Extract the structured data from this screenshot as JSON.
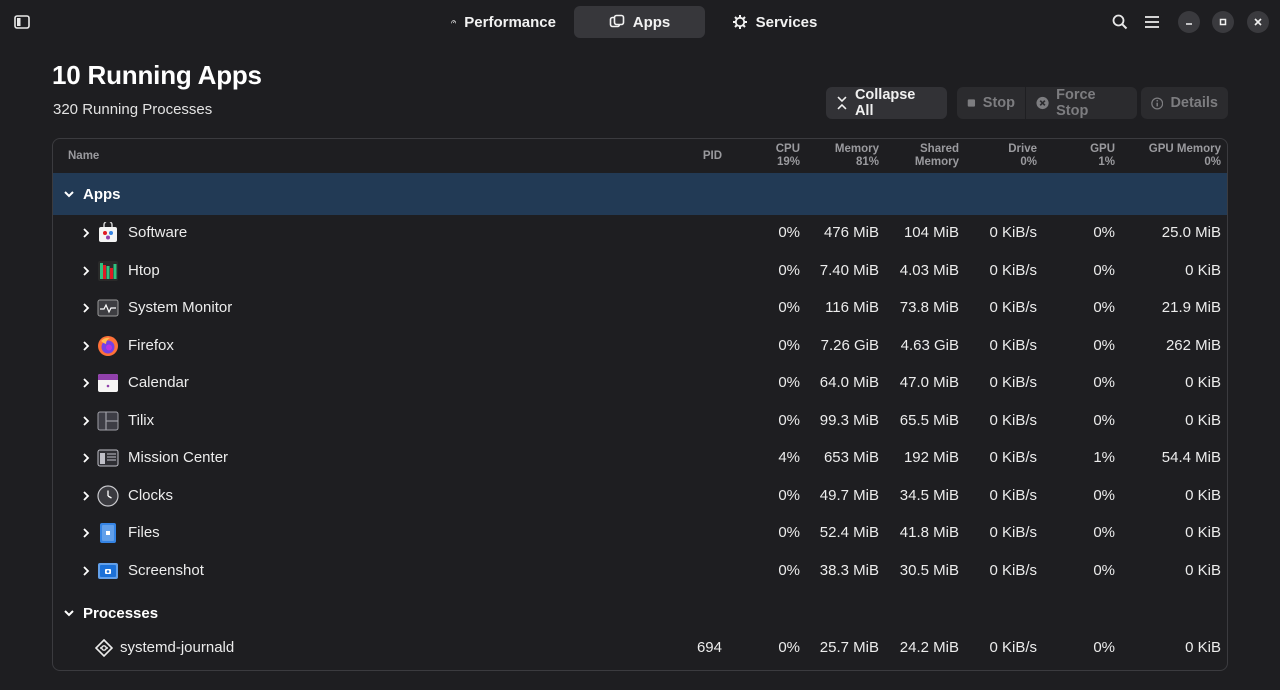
{
  "header": {
    "tabs": [
      {
        "label": "Performance",
        "icon": "gauge-icon"
      },
      {
        "label": "Apps",
        "icon": "apps-icon",
        "selected": true
      },
      {
        "label": "Services",
        "icon": "gear-icon"
      }
    ]
  },
  "page": {
    "title": "10 Running Apps",
    "subtitle": "320 Running Processes"
  },
  "actions": {
    "collapse_all": "Collapse All",
    "stop": "Stop",
    "force_stop": "Force Stop",
    "details": "Details"
  },
  "table": {
    "columns": {
      "name": "Name",
      "pid": "PID",
      "cpu": [
        "CPU",
        "19%"
      ],
      "memory": [
        "Memory",
        "81%"
      ],
      "shared_memory": [
        "Shared",
        "Memory"
      ],
      "drive": [
        "Drive",
        "0%"
      ],
      "gpu": [
        "GPU",
        "1%"
      ],
      "gpu_memory": [
        "GPU Memory",
        "0%"
      ]
    },
    "sections": {
      "apps": "Apps",
      "processes": "Processes"
    },
    "apps": [
      {
        "name": "Software",
        "icon": "software-icon",
        "cpu": "0%",
        "memory": "476 MiB",
        "shared": "104 MiB",
        "drive": "0 KiB/s",
        "gpu": "0%",
        "gpu_memory": "25.0 MiB"
      },
      {
        "name": "Htop",
        "icon": "htop-icon",
        "cpu": "0%",
        "memory": "7.40 MiB",
        "shared": "4.03 MiB",
        "drive": "0 KiB/s",
        "gpu": "0%",
        "gpu_memory": "0 KiB"
      },
      {
        "name": "System Monitor",
        "icon": "system-monitor-icon",
        "cpu": "0%",
        "memory": "116 MiB",
        "shared": "73.8 MiB",
        "drive": "0 KiB/s",
        "gpu": "0%",
        "gpu_memory": "21.9 MiB"
      },
      {
        "name": "Firefox",
        "icon": "firefox-icon",
        "cpu": "0%",
        "memory": "7.26 GiB",
        "shared": "4.63 GiB",
        "drive": "0 KiB/s",
        "gpu": "0%",
        "gpu_memory": "262 MiB"
      },
      {
        "name": "Calendar",
        "icon": "calendar-icon",
        "cpu": "0%",
        "memory": "64.0 MiB",
        "shared": "47.0 MiB",
        "drive": "0 KiB/s",
        "gpu": "0%",
        "gpu_memory": "0 KiB"
      },
      {
        "name": "Tilix",
        "icon": "tilix-icon",
        "cpu": "0%",
        "memory": "99.3 MiB",
        "shared": "65.5 MiB",
        "drive": "0 KiB/s",
        "gpu": "0%",
        "gpu_memory": "0 KiB"
      },
      {
        "name": "Mission Center",
        "icon": "mission-center-icon",
        "cpu": "4%",
        "memory": "653 MiB",
        "shared": "192 MiB",
        "drive": "0 KiB/s",
        "gpu": "1%",
        "gpu_memory": "54.4 MiB"
      },
      {
        "name": "Clocks",
        "icon": "clocks-icon",
        "cpu": "0%",
        "memory": "49.7 MiB",
        "shared": "34.5 MiB",
        "drive": "0 KiB/s",
        "gpu": "0%",
        "gpu_memory": "0 KiB"
      },
      {
        "name": "Files",
        "icon": "files-icon",
        "cpu": "0%",
        "memory": "52.4 MiB",
        "shared": "41.8 MiB",
        "drive": "0 KiB/s",
        "gpu": "0%",
        "gpu_memory": "0 KiB"
      },
      {
        "name": "Screenshot",
        "icon": "screenshot-icon",
        "cpu": "0%",
        "memory": "38.3 MiB",
        "shared": "30.5 MiB",
        "drive": "0 KiB/s",
        "gpu": "0%",
        "gpu_memory": "0 KiB"
      }
    ],
    "processes": [
      {
        "name": "systemd-journald",
        "icon": "service-icon",
        "pid": "694",
        "cpu": "0%",
        "memory": "25.7 MiB",
        "shared": "24.2 MiB",
        "drive": "0 KiB/s",
        "gpu": "0%",
        "gpu_memory": "0 KiB"
      }
    ]
  },
  "colors": {
    "background": "#1e1e21",
    "selected_row": "#223a55",
    "selected_tab": "#37373b",
    "border": "#3b3b3f"
  }
}
